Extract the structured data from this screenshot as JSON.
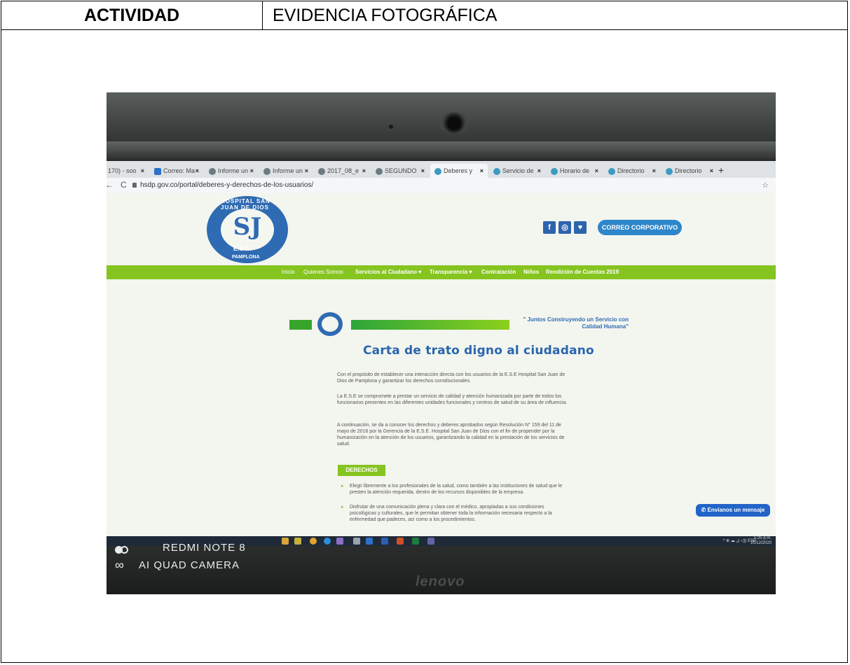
{
  "header": {
    "col1": "ACTIVIDAD",
    "col2": "EVIDENCIA FOTOGRÁFICA"
  },
  "browser": {
    "tabs": [
      {
        "label": "170) - soo"
      },
      {
        "label": "Correo: Ma"
      },
      {
        "label": "Informe un"
      },
      {
        "label": "Informe un"
      },
      {
        "label": "2017_08_e"
      },
      {
        "label": "SEGUNDO"
      },
      {
        "label": "Deberes y"
      },
      {
        "label": "Servicio de"
      },
      {
        "label": "Horario de"
      },
      {
        "label": "Directorio"
      },
      {
        "label": "Directorio"
      }
    ],
    "tab_close": "×",
    "new_tab": "+",
    "url": "hsdp.gov.co/portal/deberes-y-derechos-de-los-usuarios/",
    "back": "←",
    "reload": "C",
    "bookmark": "☆"
  },
  "site": {
    "logo_top": "HOSPITAL SAN JUAN DE DIOS",
    "logo_letters": "SJ",
    "logo_ese": "E.S.E.",
    "logo_bottom": "PAMPLONA",
    "social": [
      "f",
      "◎",
      "♥"
    ],
    "corp_button": "CORREO CORPORATIVO",
    "nav": [
      "Inicio",
      "Quienes Somos",
      "Servicios al Ciudadano ▾",
      "Transparencia ▾",
      "Contratación",
      "Niños",
      "Rendición de Cuentas 2019"
    ],
    "slogan": "\" Juntos Construyendo un Servicio con Calidad Humana\"",
    "title": "Carta de trato digno al ciudadano",
    "paragraphs": [
      "Con el propósito de establecer una interacción directa con los usuarios de la E.S.E Hospital San Juan de Dios de Pamplona y garantizar los derechos constitucionales.",
      "La E.S.E se compromete a prestar un servicio de calidad y atención humanizada por parte de todos los funcionarios presentes en las diferentes unidades funcionales y centros de salud de su área de influencia.",
      "A continuación, se da a conocer los derechos y deberes aprobados según Resolución N° 159 del 11 de mayo de 2016 por la Gerencia de la E.S.E. Hospital San Juan de Dios con el fin de propender por la humanización en la atención de los usuarios, garantizando la calidad en la prestación de los servicios de salud."
    ],
    "derechos_label": "DERECHOS",
    "bullets": [
      "Elegir libremente a los profesionales de la salud, como también a las instituciones de salud que le presten la atención requerida, dentro de los recursos disponibles de la empresa.",
      "Disfrutar de una comunicación plena y clara con el médico, apropiadas a sus condiciones psicológicas y culturales, que le permitan obtener toda la información necesaria respecto a la enfermedad que padeces, así como a los procedimientos."
    ],
    "message_button": "✆ Envíanos un mensaje"
  },
  "taskbar": {
    "tray": "^ ⊕ ☁ ◿ ◁)) ESP",
    "time": "5:35 p.m.",
    "date": "10/12/2020"
  },
  "photo": {
    "watermark_line1": "REDMI NOTE 8",
    "watermark_line2": "AI QUAD CAMERA",
    "laptop_brand": "lenovo"
  }
}
